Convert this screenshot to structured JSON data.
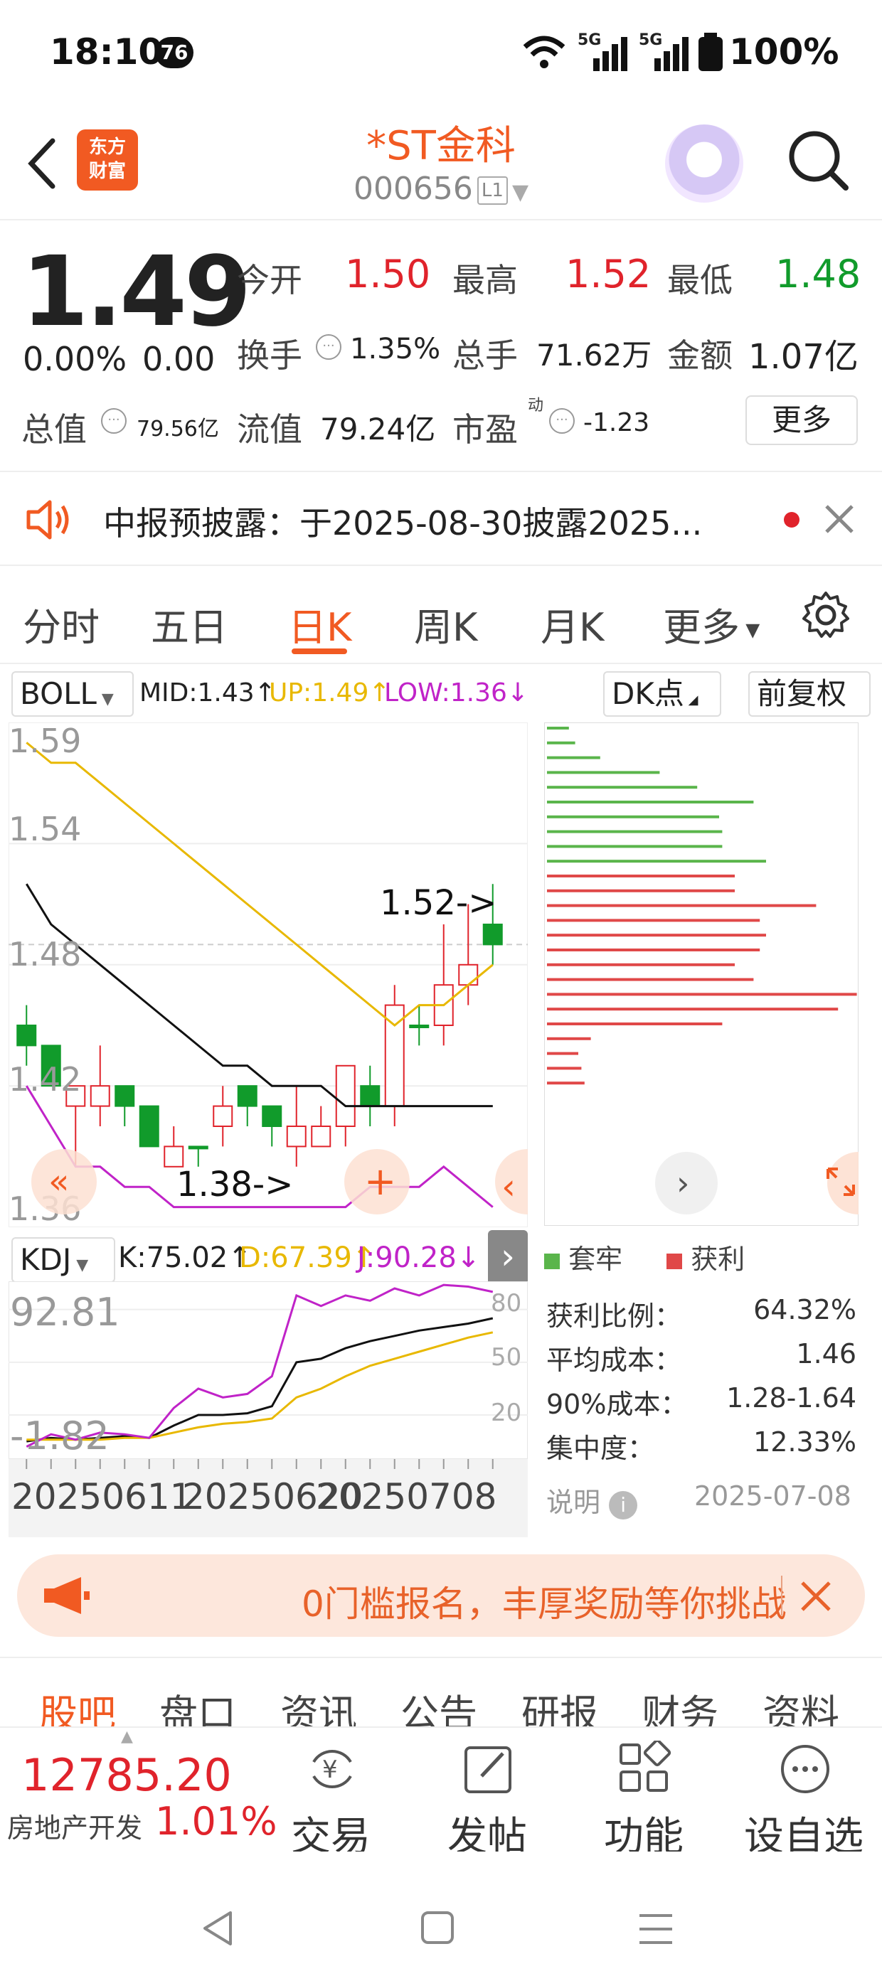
{
  "status_bar": {
    "time": "18:10",
    "badge": "76",
    "signal_1": "5G",
    "signal_2": "5G",
    "battery": "100%"
  },
  "header": {
    "title": "*ST金科",
    "code": "000656",
    "level": "L1",
    "logo_text_1": "东方",
    "logo_text_2": "财富"
  },
  "quote": {
    "price": "1.49",
    "change_pct": "0.00%",
    "change": "0.00",
    "open_label": "今开",
    "open": "1.50",
    "high_label": "最高",
    "high": "1.52",
    "low_label": "最低",
    "low": "1.48",
    "turnover_label": "换手",
    "turnover": "1.35%",
    "volume_label": "总手",
    "volume": "71.62万",
    "amount_label": "金额",
    "amount": "1.07亿",
    "mktcap_label": "总值",
    "mktcap": "79.56亿",
    "float_label": "流值",
    "float_cap": "79.24亿",
    "pe_label": "市盈",
    "pe_sup": "动",
    "pe": "-1.23",
    "more_label": "更多"
  },
  "notice": {
    "text": "中报预披露：于2025-08-30披露2025..."
  },
  "tabs": [
    "分时",
    "五日",
    "日K",
    "周K",
    "月K",
    "更多"
  ],
  "active_tab": "日K",
  "indicator_bar": {
    "selector": "BOLL",
    "mid": "MID:1.43↑",
    "up": "UP:1.49↑",
    "low": "LOW:1.36↓",
    "dk_label": "DK点",
    "adjust_label": "前复权"
  },
  "kline": {
    "price_labels": [
      "1.59",
      "1.54",
      "1.48",
      "1.42",
      "1.36"
    ],
    "max_marker": "1.52->",
    "min_marker": "1.38->"
  },
  "kdj": {
    "selector": "KDJ",
    "k": "K:75.02↑",
    "d": "D:67.39↑",
    "j": "J:90.28↓",
    "top_label": "92.81",
    "bottom_label": "-1.82",
    "levels": [
      "80",
      "50",
      "20"
    ],
    "dates": [
      "20250611",
      "20250620",
      "20250708"
    ]
  },
  "chips": {
    "legend_trapped": "套牢",
    "legend_profit": "获利",
    "rows": [
      {
        "label": "获利比例：",
        "value": "64.32%"
      },
      {
        "label": "平均成本：",
        "value": "1.46"
      },
      {
        "label": "90%成本：",
        "value": "1.28-1.64"
      },
      {
        "label": "集中度：",
        "value": "12.33%"
      }
    ],
    "note_label": "说明",
    "date": "2025-07-08"
  },
  "banner": {
    "text": "0门槛报名，丰厚奖励等你挑战"
  },
  "bottom_tabs": [
    "股吧",
    "盘口",
    "资讯",
    "公告",
    "研报",
    "财务",
    "资料"
  ],
  "active_bottom_tab": "股吧",
  "toolbar": {
    "index_value": "12785.20",
    "index_name": "房地产开发",
    "index_pct": "1.01%",
    "trade": "交易",
    "post": "发帖",
    "function": "功能",
    "watchlist": "设自选"
  },
  "colors": {
    "accent": "#f15a22",
    "up": "#e0232b",
    "down": "#119b2b",
    "boll_up": "#e8b800",
    "boll_low": "#c023c8"
  },
  "chart_data": [
    {
      "type": "candlestick",
      "ylim": [
        1.35,
        1.6
      ],
      "candles": [
        {
          "o": 1.44,
          "c": 1.45,
          "h": 1.46,
          "l": 1.43,
          "dir": "down"
        },
        {
          "o": 1.44,
          "c": 1.42,
          "h": 1.44,
          "l": 1.42,
          "dir": "down"
        },
        {
          "o": 1.42,
          "c": 1.41,
          "h": 1.42,
          "l": 1.38,
          "dir": "up"
        },
        {
          "o": 1.41,
          "c": 1.42,
          "h": 1.44,
          "l": 1.4,
          "dir": "up"
        },
        {
          "o": 1.42,
          "c": 1.41,
          "h": 1.42,
          "l": 1.4,
          "dir": "down"
        },
        {
          "o": 1.41,
          "c": 1.39,
          "h": 1.41,
          "l": 1.39,
          "dir": "down"
        },
        {
          "o": 1.39,
          "c": 1.38,
          "h": 1.4,
          "l": 1.38,
          "dir": "up"
        },
        {
          "o": 1.39,
          "c": 1.39,
          "h": 1.39,
          "l": 1.38,
          "dir": "flat"
        },
        {
          "o": 1.4,
          "c": 1.41,
          "h": 1.42,
          "l": 1.39,
          "dir": "up"
        },
        {
          "o": 1.42,
          "c": 1.41,
          "h": 1.42,
          "l": 1.4,
          "dir": "down"
        },
        {
          "o": 1.41,
          "c": 1.4,
          "h": 1.41,
          "l": 1.39,
          "dir": "down"
        },
        {
          "o": 1.39,
          "c": 1.4,
          "h": 1.42,
          "l": 1.38,
          "dir": "up"
        },
        {
          "o": 1.39,
          "c": 1.4,
          "h": 1.41,
          "l": 1.39,
          "dir": "up"
        },
        {
          "o": 1.4,
          "c": 1.43,
          "h": 1.43,
          "l": 1.39,
          "dir": "up"
        },
        {
          "o": 1.42,
          "c": 1.41,
          "h": 1.43,
          "l": 1.4,
          "dir": "down"
        },
        {
          "o": 1.41,
          "c": 1.46,
          "h": 1.47,
          "l": 1.4,
          "dir": "up"
        },
        {
          "o": 1.45,
          "c": 1.45,
          "h": 1.46,
          "l": 1.44,
          "dir": "flat"
        },
        {
          "o": 1.45,
          "c": 1.47,
          "h": 1.5,
          "l": 1.44,
          "dir": "up"
        },
        {
          "o": 1.47,
          "c": 1.48,
          "h": 1.51,
          "l": 1.46,
          "dir": "up"
        },
        {
          "o": 1.5,
          "c": 1.49,
          "h": 1.52,
          "l": 1.48,
          "dir": "down"
        }
      ],
      "boll_up": [
        1.59,
        1.58,
        1.58,
        1.57,
        1.56,
        1.55,
        1.54,
        1.53,
        1.52,
        1.51,
        1.5,
        1.49,
        1.48,
        1.47,
        1.46,
        1.45,
        1.46,
        1.46,
        1.47,
        1.48
      ],
      "boll_mid": [
        1.52,
        1.5,
        1.49,
        1.48,
        1.47,
        1.46,
        1.45,
        1.44,
        1.43,
        1.43,
        1.42,
        1.42,
        1.42,
        1.41,
        1.41,
        1.41,
        1.41,
        1.41,
        1.41,
        1.41
      ],
      "boll_low": [
        1.42,
        1.4,
        1.38,
        1.38,
        1.37,
        1.37,
        1.36,
        1.36,
        1.36,
        1.36,
        1.36,
        1.36,
        1.36,
        1.36,
        1.37,
        1.37,
        1.37,
        1.38,
        1.37,
        1.36
      ]
    },
    {
      "type": "line",
      "ylim": [
        -1.82,
        92.81
      ],
      "series": [
        {
          "name": "K",
          "values": [
            5,
            7,
            6,
            7,
            8,
            7,
            14,
            20,
            20,
            21,
            25,
            50,
            52,
            58,
            62,
            65,
            68,
            70,
            72,
            75
          ]
        },
        {
          "name": "D",
          "values": [
            6,
            6,
            6,
            6,
            7,
            7,
            10,
            13,
            15,
            16,
            18,
            30,
            35,
            42,
            48,
            52,
            56,
            60,
            64,
            67
          ]
        },
        {
          "name": "J",
          "values": [
            2,
            9,
            6,
            10,
            9,
            7,
            24,
            35,
            30,
            32,
            42,
            88,
            82,
            88,
            85,
            92,
            88,
            94,
            93,
            90
          ]
        }
      ]
    },
    {
      "type": "bar",
      "orientation": "horizontal",
      "trapped": [
        0.07,
        0.09,
        0.17,
        0.36,
        0.48,
        0.66,
        0.55,
        0.56,
        0.56,
        0.7
      ],
      "profit": [
        0.6,
        0.6,
        0.86,
        0.68,
        0.7,
        0.68,
        0.6,
        0.66,
        0.99,
        0.93,
        0.56,
        0.14,
        0.1,
        0.11,
        0.12
      ]
    }
  ]
}
